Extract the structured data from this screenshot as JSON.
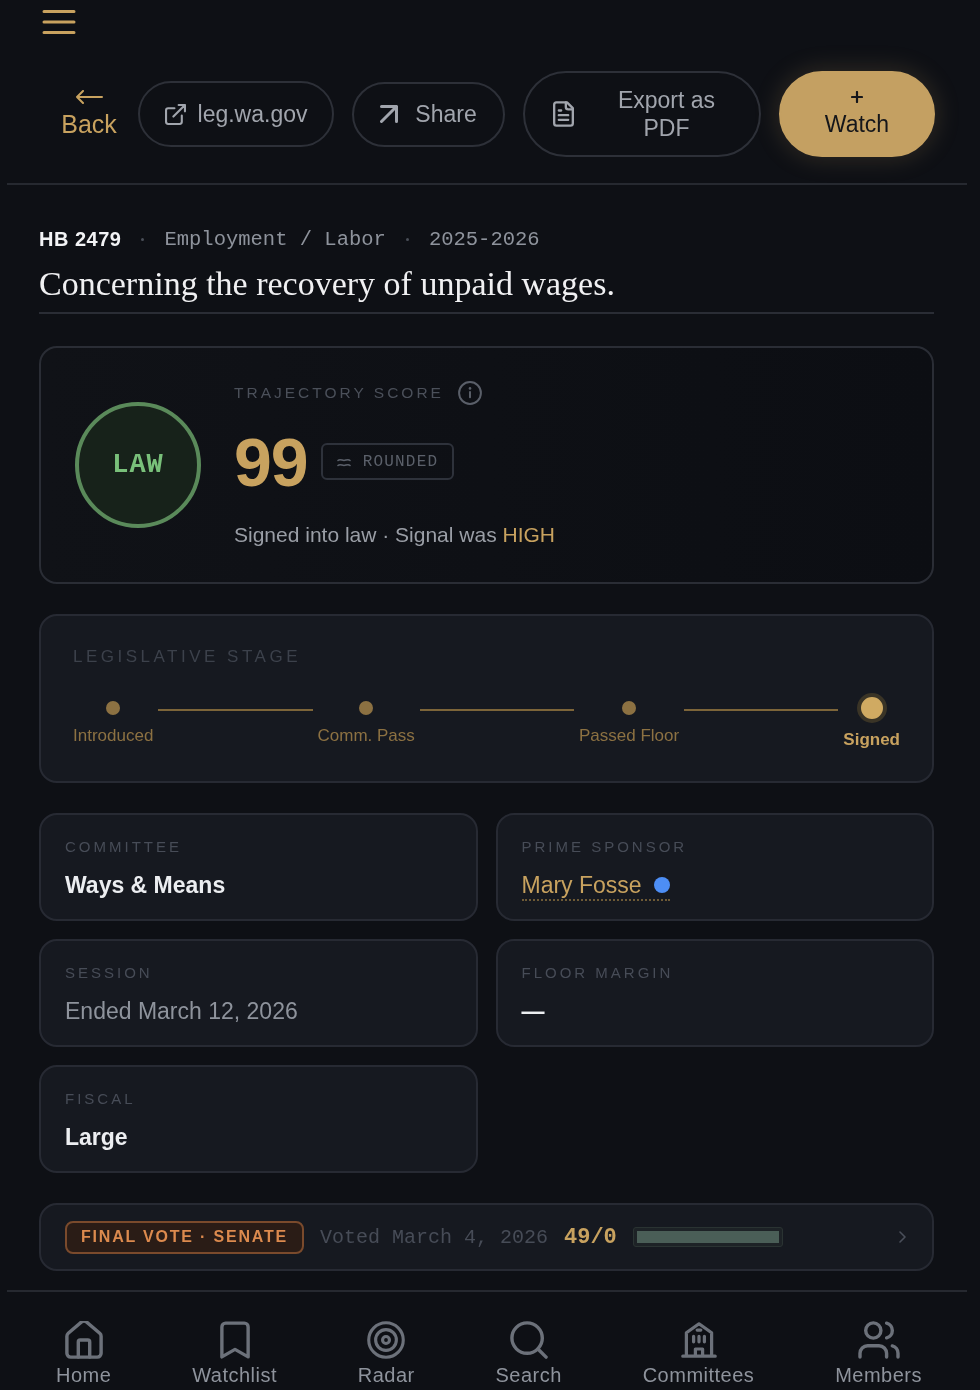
{
  "toolbar": {
    "back": "Back",
    "buttons": [
      {
        "kind": "link",
        "label": "leg.wa.gov"
      },
      {
        "kind": "share",
        "label": "Share"
      },
      {
        "kind": "export",
        "label": "Export as PDF"
      },
      {
        "kind": "watch",
        "label": "Watch"
      }
    ]
  },
  "bill": {
    "number": "HB 2479",
    "topic": "Employment / Labor",
    "session": "2025-2026",
    "title": "Concerning the recovery of unpaid wages."
  },
  "score_card": {
    "status": "LAW",
    "label": "TRAJECTORY SCORE",
    "score": "99",
    "qualifier": "ROUNDED",
    "summary": "Signed into law · Signal was",
    "signal": "HIGH"
  },
  "stage": {
    "label": "LEGISLATIVE STAGE",
    "stages": [
      {
        "label": "Introduced",
        "done": true,
        "current": false
      },
      {
        "label": "Comm. Pass",
        "done": true,
        "current": false
      },
      {
        "label": "Passed Floor",
        "done": true,
        "current": false
      },
      {
        "label": "Signed",
        "done": true,
        "current": true
      }
    ]
  },
  "details": [
    {
      "kind": "text",
      "label": "COMMITTEE",
      "value": "Ways & Means"
    },
    {
      "kind": "person",
      "label": "PRIME SPONSOR",
      "value": "Mary Fosse",
      "color": "#4d8ef5"
    },
    {
      "kind": "muted",
      "label": "SESSION",
      "value": "Ended March 12, 2026"
    },
    {
      "kind": "text",
      "label": "FLOOR MARGIN",
      "value": "—"
    },
    {
      "kind": "text",
      "label": "FISCAL",
      "value": "Large"
    }
  ],
  "vote": {
    "tag": "FINAL VOTE · SENATE",
    "date": "Voted March 4, 2026",
    "tally": "49/0",
    "level": 1
  },
  "nav": [
    {
      "label": "Home",
      "selected": false
    },
    {
      "label": "Watchlist",
      "selected": false
    },
    {
      "label": "Radar",
      "selected": false
    },
    {
      "label": "Search",
      "selected": false
    },
    {
      "label": "Committees",
      "selected": false
    },
    {
      "label": "Members",
      "selected": false
    }
  ]
}
